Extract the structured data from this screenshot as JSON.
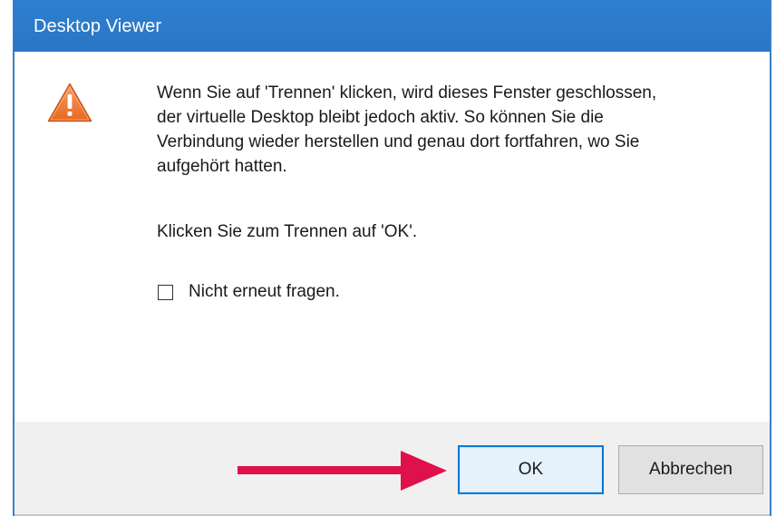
{
  "window": {
    "title": "Desktop Viewer"
  },
  "icon": "warning-icon",
  "message": {
    "lines": [
      "Wenn Sie auf 'Trennen' klicken, wird dieses Fenster geschlossen,",
      "der virtuelle Desktop bleibt jedoch aktiv. So können Sie die",
      "Verbindung wieder herstellen und genau dort fortfahren, wo Sie",
      "aufgehört hatten."
    ],
    "confirm": "Klicken Sie zum Trennen auf 'OK'."
  },
  "checkbox": {
    "label": "Nicht erneut fragen.",
    "checked": false
  },
  "buttons": {
    "ok_label": "OK",
    "cancel_label": "Abbrechen"
  },
  "annotation": {
    "arrow_color": "#e0104a",
    "points_to": "ok-button"
  },
  "colors": {
    "titlebar": "#2b79c9",
    "footer": "#f0f0f0",
    "accent": "#0078d7"
  }
}
